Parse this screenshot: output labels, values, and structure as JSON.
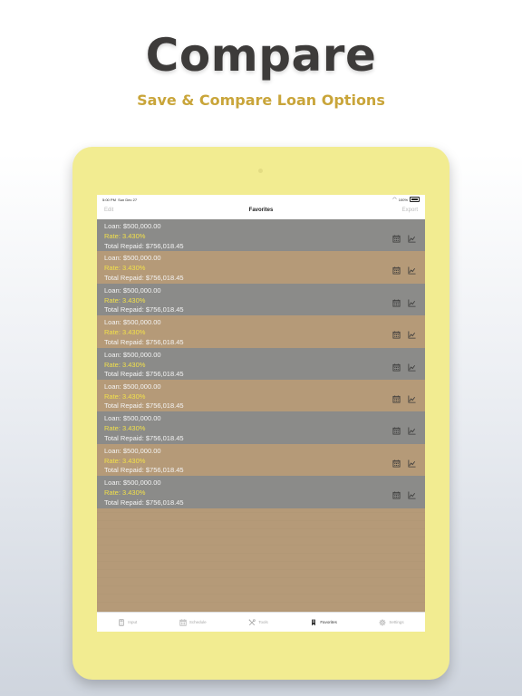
{
  "headline": "Compare",
  "subheadline": "Save & Compare Loan Options",
  "colors": {
    "accent": "#c9a53a",
    "tablet": "#f2ec91",
    "rate": "#f2e04a",
    "row_gray": "#8b8b89",
    "row_tan": "#b59a78"
  },
  "status": {
    "time": "5:00 PM",
    "date": "Sun Dec 27",
    "battery": "100%"
  },
  "navbar": {
    "edit": "Edit",
    "title": "Favorites",
    "export": "Export"
  },
  "favorites": [
    {
      "loan": "Loan: $500,000.00",
      "rate": "Rate: 3.430%",
      "total": "Total Repaid: $756,018.45"
    },
    {
      "loan": "Loan: $500,000.00",
      "rate": "Rate: 3.430%",
      "total": "Total Repaid: $756,018.45"
    },
    {
      "loan": "Loan: $500,000.00",
      "rate": "Rate: 3.430%",
      "total": "Total Repaid: $756,018.45"
    },
    {
      "loan": "Loan: $500,000.00",
      "rate": "Rate: 3.430%",
      "total": "Total Repaid: $756,018.45"
    },
    {
      "loan": "Loan: $500,000.00",
      "rate": "Rate: 3.430%",
      "total": "Total Repaid: $756,018.45"
    },
    {
      "loan": "Loan: $500,000.00",
      "rate": "Rate: 3.430%",
      "total": "Total Repaid: $756,018.45"
    },
    {
      "loan": "Loan: $500,000.00",
      "rate": "Rate: 3.430%",
      "total": "Total Repaid: $756,018.45"
    },
    {
      "loan": "Loan: $500,000.00",
      "rate": "Rate: 3.430%",
      "total": "Total Repaid: $756,018.45"
    },
    {
      "loan": "Loan: $500,000.00",
      "rate": "Rate: 3.430%",
      "total": "Total Repaid: $756,018.45"
    }
  ],
  "row_icons": {
    "schedule": "calendar-icon",
    "chart": "chart-icon"
  },
  "tabs": [
    {
      "label": "Input",
      "icon": "calculator-icon",
      "active": false
    },
    {
      "label": "Schedule",
      "icon": "calendar-icon",
      "active": false
    },
    {
      "label": "Tools",
      "icon": "tools-icon",
      "active": false
    },
    {
      "label": "Favorites",
      "icon": "bookmark-icon",
      "active": true
    },
    {
      "label": "Settings",
      "icon": "gear-icon",
      "active": false
    }
  ]
}
